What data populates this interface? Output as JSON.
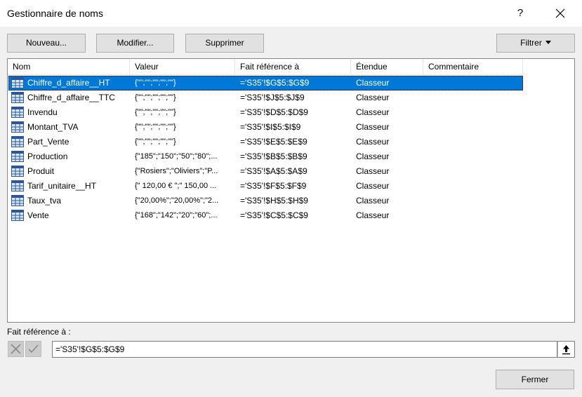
{
  "window": {
    "title": "Gestionnaire de noms",
    "help_label": "?"
  },
  "toolbar": {
    "new_label": "Nouveau...",
    "edit_label": "Modifier...",
    "delete_label": "Supprimer",
    "filter_label": "Filtrer"
  },
  "table": {
    "columns": [
      "Nom",
      "Valeur",
      "Fait référence à",
      "Étendue",
      "Commentaire"
    ],
    "rows": [
      {
        "name": "Chiffre_d_affaire__HT",
        "value": "{\"\";\"\";\"\";\"\";\"\"}",
        "ref": "='S35'!$G$5:$G$9",
        "scope": "Classeur",
        "comment": ""
      },
      {
        "name": "Chiffre_d_affaire__TTC",
        "value": "{\"\";\"\";\"\";\"\";\"\"}",
        "ref": "='S35'!$J$5:$J$9",
        "scope": "Classeur",
        "comment": ""
      },
      {
        "name": "Invendu",
        "value": "{\"\";\"\";\"\";\"\";\"\"}",
        "ref": "='S35'!$D$5:$D$9",
        "scope": "Classeur",
        "comment": ""
      },
      {
        "name": "Montant_TVA",
        "value": "{\"\";\"\";\"\";\"\";\"\"}",
        "ref": "='S35'!$I$5:$I$9",
        "scope": "Classeur",
        "comment": ""
      },
      {
        "name": "Part_Vente",
        "value": "{\"\";\"\";\"\";\"\";\"\"}",
        "ref": "='S35'!$E$5:$E$9",
        "scope": "Classeur",
        "comment": ""
      },
      {
        "name": "Production",
        "value": "{\"185\";\"150\";\"50\";\"80\";...",
        "ref": "='S35'!$B$5:$B$9",
        "scope": "Classeur",
        "comment": ""
      },
      {
        "name": "Produit",
        "value": "{\"Rosiers\";\"Oliviers\";\"P...",
        "ref": "='S35'!$A$5:$A$9",
        "scope": "Classeur",
        "comment": ""
      },
      {
        "name": "Tarif_unitaire__HT",
        "value": "{\" 120,00 € \";\" 150,00 ...",
        "ref": "='S35'!$F$5:$F$9",
        "scope": "Classeur",
        "comment": ""
      },
      {
        "name": "Taux_tva",
        "value": "{\"20,00%\";\"20,00%\";\"2...",
        "ref": "='S35'!$H$5:$H$9",
        "scope": "Classeur",
        "comment": ""
      },
      {
        "name": "Vente",
        "value": "{\"168\";\"142\";\"20\";\"60\";...",
        "ref": "='S35'!$C$5:$C$9",
        "scope": "Classeur",
        "comment": ""
      }
    ],
    "selected_index": 0
  },
  "refers_to": {
    "label": "Fait référence à :",
    "value": "='S35'!$G$5:$G$9"
  },
  "footer": {
    "close_label": "Fermer"
  },
  "colors": {
    "selection": "#0078d7",
    "dialog_bg": "#f0f0f0",
    "button_bg": "#e1e1e1"
  }
}
